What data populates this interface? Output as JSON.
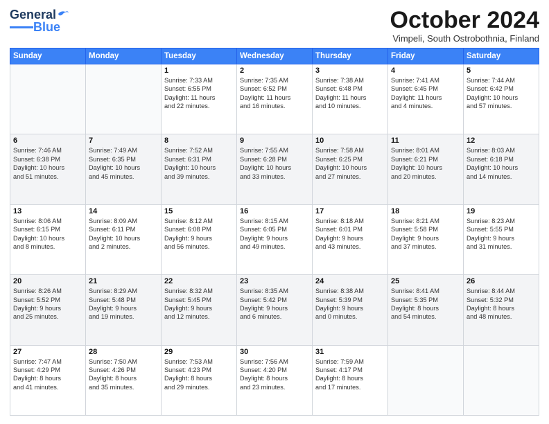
{
  "logo": {
    "text1": "General",
    "text2": "Blue"
  },
  "header": {
    "month": "October 2024",
    "location": "Vimpeli, South Ostrobothnia, Finland"
  },
  "weekdays": [
    "Sunday",
    "Monday",
    "Tuesday",
    "Wednesday",
    "Thursday",
    "Friday",
    "Saturday"
  ],
  "weeks": [
    [
      {
        "day": "",
        "lines": []
      },
      {
        "day": "",
        "lines": []
      },
      {
        "day": "1",
        "lines": [
          "Sunrise: 7:33 AM",
          "Sunset: 6:55 PM",
          "Daylight: 11 hours",
          "and 22 minutes."
        ]
      },
      {
        "day": "2",
        "lines": [
          "Sunrise: 7:35 AM",
          "Sunset: 6:52 PM",
          "Daylight: 11 hours",
          "and 16 minutes."
        ]
      },
      {
        "day": "3",
        "lines": [
          "Sunrise: 7:38 AM",
          "Sunset: 6:48 PM",
          "Daylight: 11 hours",
          "and 10 minutes."
        ]
      },
      {
        "day": "4",
        "lines": [
          "Sunrise: 7:41 AM",
          "Sunset: 6:45 PM",
          "Daylight: 11 hours",
          "and 4 minutes."
        ]
      },
      {
        "day": "5",
        "lines": [
          "Sunrise: 7:44 AM",
          "Sunset: 6:42 PM",
          "Daylight: 10 hours",
          "and 57 minutes."
        ]
      }
    ],
    [
      {
        "day": "6",
        "lines": [
          "Sunrise: 7:46 AM",
          "Sunset: 6:38 PM",
          "Daylight: 10 hours",
          "and 51 minutes."
        ]
      },
      {
        "day": "7",
        "lines": [
          "Sunrise: 7:49 AM",
          "Sunset: 6:35 PM",
          "Daylight: 10 hours",
          "and 45 minutes."
        ]
      },
      {
        "day": "8",
        "lines": [
          "Sunrise: 7:52 AM",
          "Sunset: 6:31 PM",
          "Daylight: 10 hours",
          "and 39 minutes."
        ]
      },
      {
        "day": "9",
        "lines": [
          "Sunrise: 7:55 AM",
          "Sunset: 6:28 PM",
          "Daylight: 10 hours",
          "and 33 minutes."
        ]
      },
      {
        "day": "10",
        "lines": [
          "Sunrise: 7:58 AM",
          "Sunset: 6:25 PM",
          "Daylight: 10 hours",
          "and 27 minutes."
        ]
      },
      {
        "day": "11",
        "lines": [
          "Sunrise: 8:01 AM",
          "Sunset: 6:21 PM",
          "Daylight: 10 hours",
          "and 20 minutes."
        ]
      },
      {
        "day": "12",
        "lines": [
          "Sunrise: 8:03 AM",
          "Sunset: 6:18 PM",
          "Daylight: 10 hours",
          "and 14 minutes."
        ]
      }
    ],
    [
      {
        "day": "13",
        "lines": [
          "Sunrise: 8:06 AM",
          "Sunset: 6:15 PM",
          "Daylight: 10 hours",
          "and 8 minutes."
        ]
      },
      {
        "day": "14",
        "lines": [
          "Sunrise: 8:09 AM",
          "Sunset: 6:11 PM",
          "Daylight: 10 hours",
          "and 2 minutes."
        ]
      },
      {
        "day": "15",
        "lines": [
          "Sunrise: 8:12 AM",
          "Sunset: 6:08 PM",
          "Daylight: 9 hours",
          "and 56 minutes."
        ]
      },
      {
        "day": "16",
        "lines": [
          "Sunrise: 8:15 AM",
          "Sunset: 6:05 PM",
          "Daylight: 9 hours",
          "and 49 minutes."
        ]
      },
      {
        "day": "17",
        "lines": [
          "Sunrise: 8:18 AM",
          "Sunset: 6:01 PM",
          "Daylight: 9 hours",
          "and 43 minutes."
        ]
      },
      {
        "day": "18",
        "lines": [
          "Sunrise: 8:21 AM",
          "Sunset: 5:58 PM",
          "Daylight: 9 hours",
          "and 37 minutes."
        ]
      },
      {
        "day": "19",
        "lines": [
          "Sunrise: 8:23 AM",
          "Sunset: 5:55 PM",
          "Daylight: 9 hours",
          "and 31 minutes."
        ]
      }
    ],
    [
      {
        "day": "20",
        "lines": [
          "Sunrise: 8:26 AM",
          "Sunset: 5:52 PM",
          "Daylight: 9 hours",
          "and 25 minutes."
        ]
      },
      {
        "day": "21",
        "lines": [
          "Sunrise: 8:29 AM",
          "Sunset: 5:48 PM",
          "Daylight: 9 hours",
          "and 19 minutes."
        ]
      },
      {
        "day": "22",
        "lines": [
          "Sunrise: 8:32 AM",
          "Sunset: 5:45 PM",
          "Daylight: 9 hours",
          "and 12 minutes."
        ]
      },
      {
        "day": "23",
        "lines": [
          "Sunrise: 8:35 AM",
          "Sunset: 5:42 PM",
          "Daylight: 9 hours",
          "and 6 minutes."
        ]
      },
      {
        "day": "24",
        "lines": [
          "Sunrise: 8:38 AM",
          "Sunset: 5:39 PM",
          "Daylight: 9 hours",
          "and 0 minutes."
        ]
      },
      {
        "day": "25",
        "lines": [
          "Sunrise: 8:41 AM",
          "Sunset: 5:35 PM",
          "Daylight: 8 hours",
          "and 54 minutes."
        ]
      },
      {
        "day": "26",
        "lines": [
          "Sunrise: 8:44 AM",
          "Sunset: 5:32 PM",
          "Daylight: 8 hours",
          "and 48 minutes."
        ]
      }
    ],
    [
      {
        "day": "27",
        "lines": [
          "Sunrise: 7:47 AM",
          "Sunset: 4:29 PM",
          "Daylight: 8 hours",
          "and 41 minutes."
        ]
      },
      {
        "day": "28",
        "lines": [
          "Sunrise: 7:50 AM",
          "Sunset: 4:26 PM",
          "Daylight: 8 hours",
          "and 35 minutes."
        ]
      },
      {
        "day": "29",
        "lines": [
          "Sunrise: 7:53 AM",
          "Sunset: 4:23 PM",
          "Daylight: 8 hours",
          "and 29 minutes."
        ]
      },
      {
        "day": "30",
        "lines": [
          "Sunrise: 7:56 AM",
          "Sunset: 4:20 PM",
          "Daylight: 8 hours",
          "and 23 minutes."
        ]
      },
      {
        "day": "31",
        "lines": [
          "Sunrise: 7:59 AM",
          "Sunset: 4:17 PM",
          "Daylight: 8 hours",
          "and 17 minutes."
        ]
      },
      {
        "day": "",
        "lines": []
      },
      {
        "day": "",
        "lines": []
      }
    ]
  ]
}
